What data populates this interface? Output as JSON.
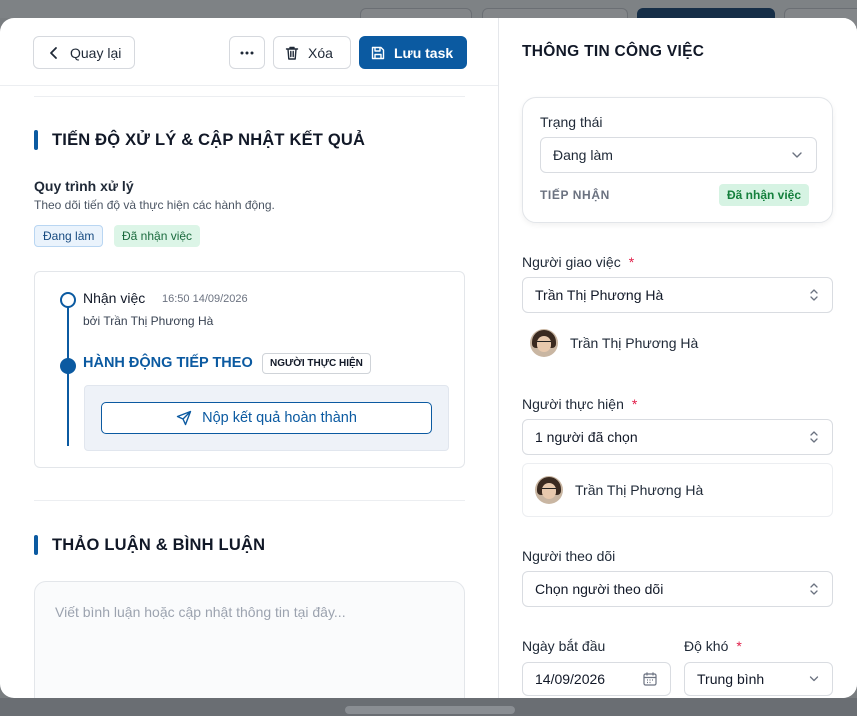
{
  "toolbar": {
    "back_label": "Quay lại",
    "more_label": "...",
    "delete_label": "Xóa",
    "save_label": "Lưu task"
  },
  "progress_section": {
    "title": "TIẾN ĐỘ XỬ LÝ & CẬP NHẬT KẾT QUẢ",
    "process_title": "Quy trình xử lý",
    "process_subtitle": "Theo dõi tiến độ và thực hiện các hành động.",
    "tags": [
      "Đang làm",
      "Đã nhận việc"
    ],
    "timeline": {
      "step_label": "Nhận việc",
      "step_time": "16:50 14/09/2026",
      "step_by": "bởi Trần Thị Phương Hà",
      "next_action_label": "HÀNH ĐỘNG TIẾP THEO",
      "role_badge": "NGƯỜI THỰC HIỆN",
      "submit_button": "Nộp kết quả hoàn thành"
    }
  },
  "discussion_section": {
    "title": "THẢO LUẬN & BÌNH LUẬN",
    "comment_placeholder": "Viết bình luận hoặc cập nhật thông tin tại đây..."
  },
  "info_panel": {
    "title": "THÔNG TIN CÔNG VIỆC",
    "status": {
      "label": "Trạng thái",
      "value": "Đang làm",
      "receive_label": "TIẾP NHẬN",
      "receive_badge": "Đã nhận việc"
    },
    "assigner": {
      "label": "Người giao việc",
      "required_mark": "*",
      "value": "Trần Thị Phương Hà",
      "person": "Trần Thị Phương Hà"
    },
    "assignee": {
      "label": "Người thực hiện",
      "required_mark": "*",
      "value": "1 người đã chọn",
      "person": "Trần Thị Phương Hà"
    },
    "watchers": {
      "label": "Người theo dõi",
      "value": "Chọn người theo dõi"
    },
    "start_date": {
      "label": "Ngày bắt đầu",
      "value": "14/09/2026"
    },
    "difficulty": {
      "label": "Độ khó",
      "required_mark": "*",
      "value": "Trung bình"
    }
  },
  "colors": {
    "primary": "#0b5aa1",
    "success_bg": "#d6f3e3",
    "success_text": "#15803d",
    "required": "#e11d48"
  }
}
